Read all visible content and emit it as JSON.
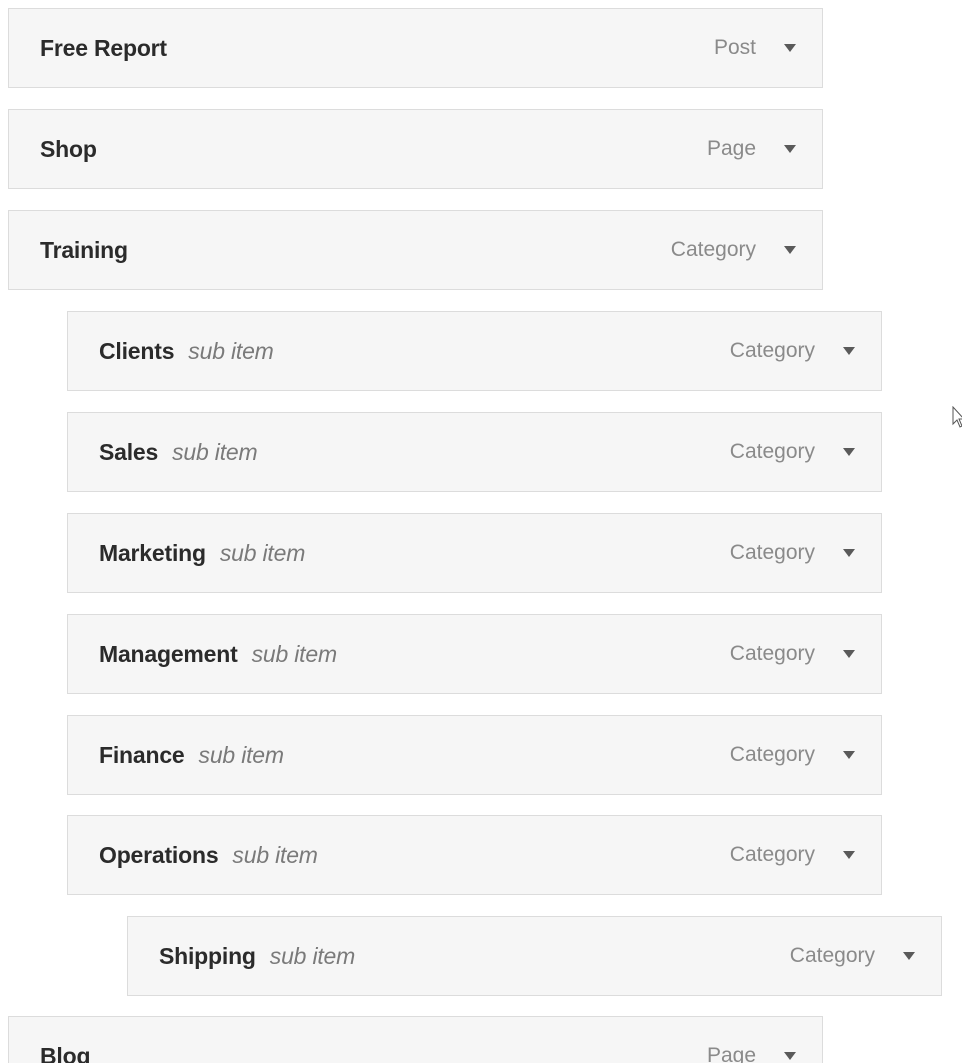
{
  "menu": {
    "items": [
      {
        "title": "Free Report",
        "sub": "",
        "type": "Post"
      },
      {
        "title": "Shop",
        "sub": "",
        "type": "Page"
      },
      {
        "title": "Training",
        "sub": "",
        "type": "Category"
      },
      {
        "title": "Clients",
        "sub": "sub item",
        "type": "Category"
      },
      {
        "title": "Sales",
        "sub": "sub item",
        "type": "Category"
      },
      {
        "title": "Marketing",
        "sub": "sub item",
        "type": "Category"
      },
      {
        "title": "Management",
        "sub": "sub item",
        "type": "Category"
      },
      {
        "title": "Finance",
        "sub": "sub item",
        "type": "Category"
      },
      {
        "title": "Operations",
        "sub": "sub item",
        "type": "Category"
      },
      {
        "title": "Shipping",
        "sub": "sub item",
        "type": "Category"
      },
      {
        "title": "Blog",
        "sub": "",
        "type": "Page"
      }
    ]
  },
  "icons": {
    "toggle": "triangle-down-icon",
    "cursor": "mouse-pointer-icon"
  },
  "colors": {
    "item_background": "#f6f6f6",
    "item_border": "#dcdcdc",
    "title": "#2b2b2b",
    "muted": "#8a8a8a"
  }
}
